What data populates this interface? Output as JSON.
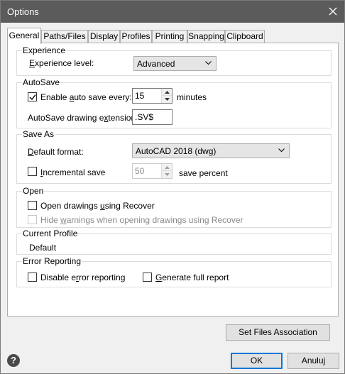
{
  "window": {
    "title": "Options"
  },
  "tabs": [
    "General",
    "Paths/Files",
    "Display",
    "Profiles",
    "Printing",
    "Snapping",
    "Clipboard"
  ],
  "experience": {
    "title": "Experience",
    "label_pre": "",
    "label_u": "E",
    "label_post": "xperience level:",
    "value": "Advanced"
  },
  "autosave": {
    "title": "AutoSave",
    "enable_pre": "Enable ",
    "enable_u": "a",
    "enable_post": "uto save every:",
    "enabled": true,
    "interval": "15",
    "unit": "minutes",
    "ext_pre": "AutoSave drawing e",
    "ext_u": "x",
    "ext_post": "tension:",
    "ext_value": ".SV$"
  },
  "saveas": {
    "title": "Save As",
    "format_pre": "",
    "format_u": "D",
    "format_post": "efault format:",
    "format_value": "AutoCAD 2018 (dwg)",
    "incremental_pre": "",
    "incremental_u": "I",
    "incremental_post": "ncremental save",
    "incremental_checked": false,
    "percent": "50",
    "percent_label": "save percent"
  },
  "open": {
    "title": "Open",
    "recover_pre": "Open drawings ",
    "recover_u": "u",
    "recover_post": "sing Recover",
    "hide_pre": "Hide ",
    "hide_u": "w",
    "hide_post": "arnings when opening drawings using Recover"
  },
  "profile": {
    "title": "Current Profile",
    "value": "Default"
  },
  "errors": {
    "title": "Error Reporting",
    "disable_pre": "Disable e",
    "disable_u": "r",
    "disable_post": "ror reporting",
    "full_pre": "",
    "full_u": "G",
    "full_post": "enerate full report"
  },
  "buttons": {
    "files": "Set Files Association",
    "ok": "OK",
    "cancel": "Anuluj"
  },
  "colors": {
    "titlebar": "#5b5b5b",
    "default_button_border": "#0078d7"
  }
}
